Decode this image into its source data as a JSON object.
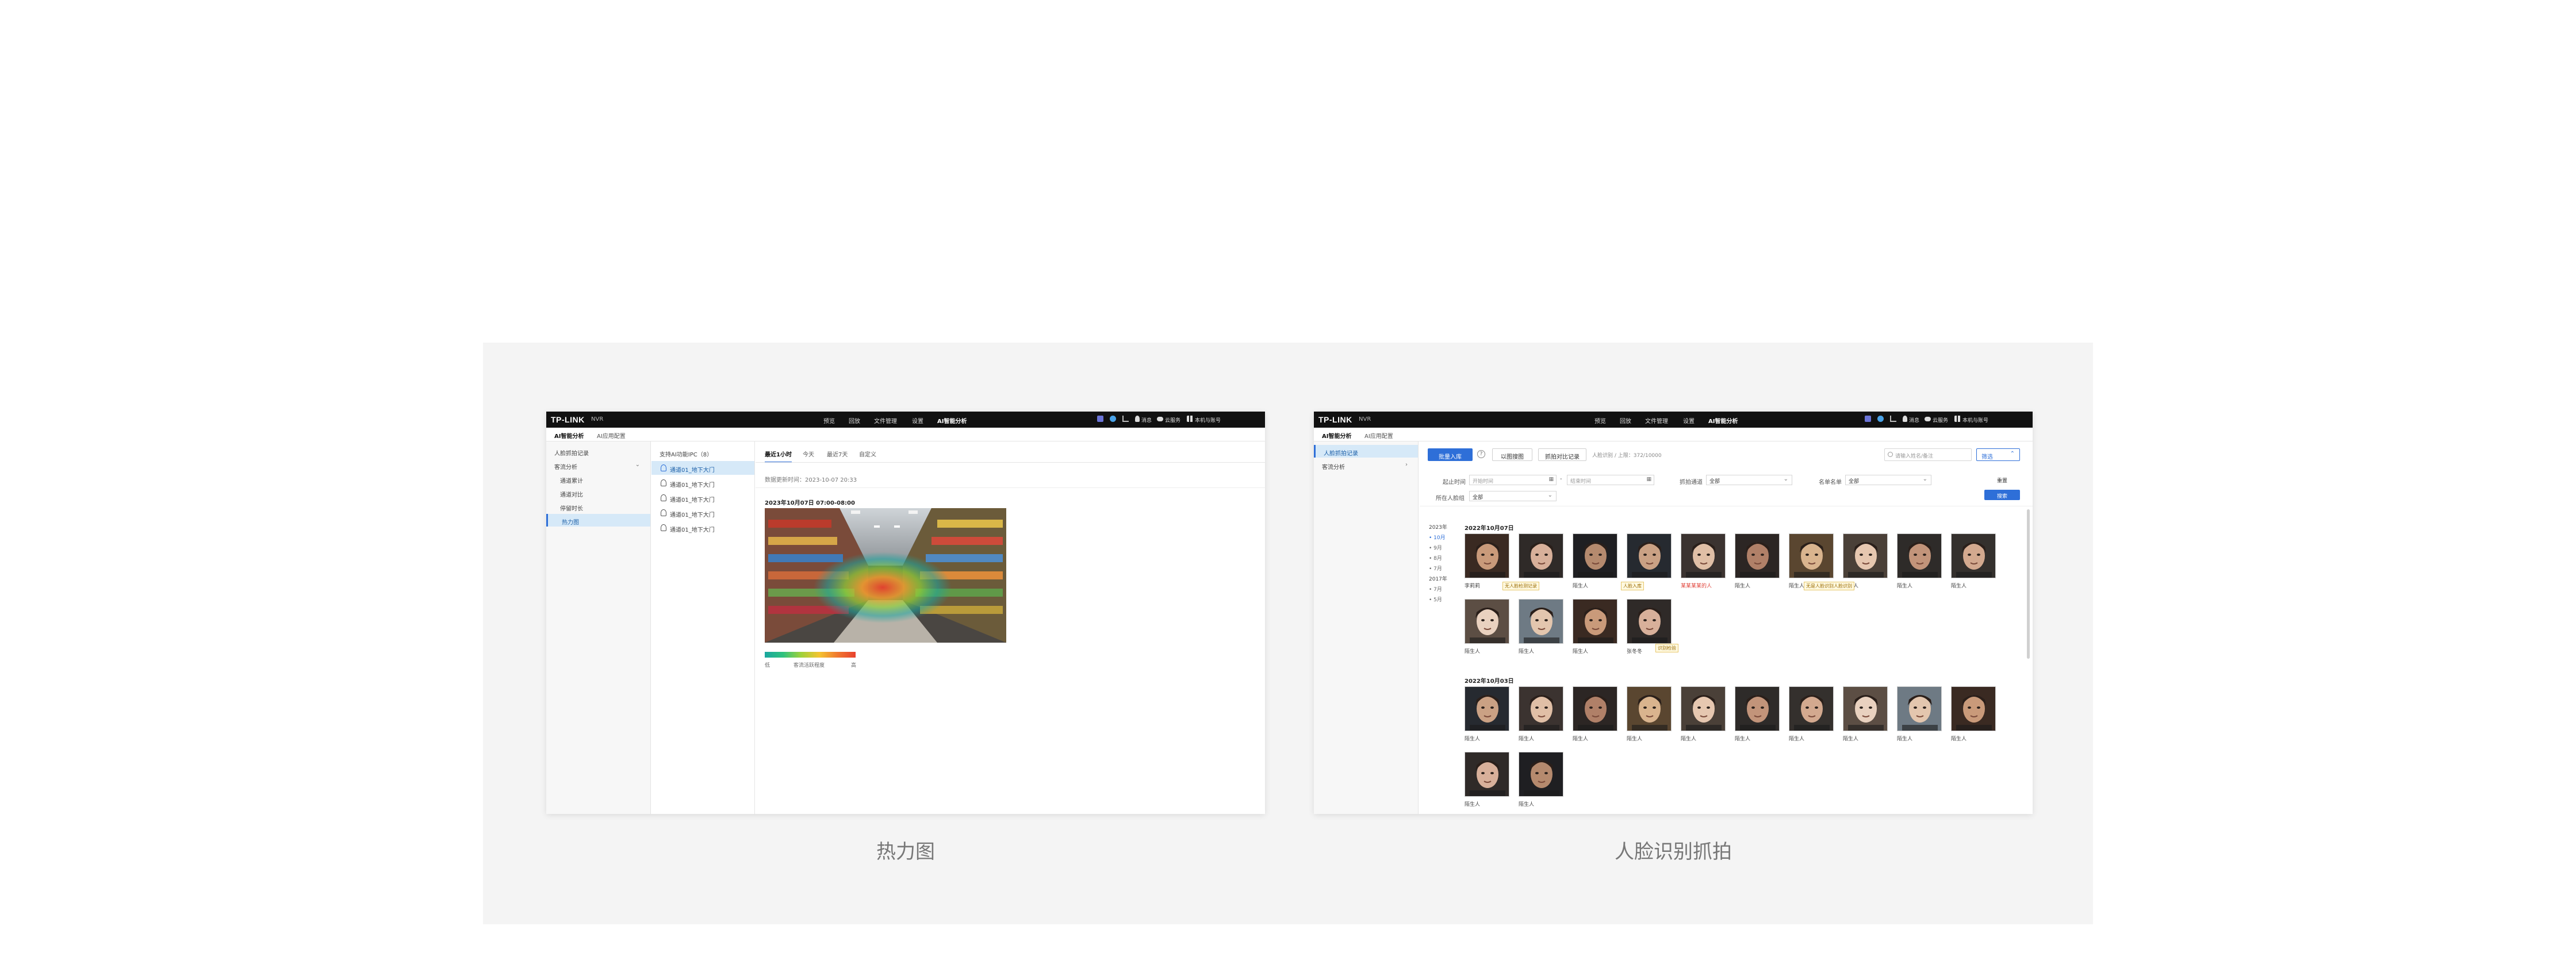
{
  "app": {
    "logo": "TP-LINK",
    "product": "NVR",
    "nav": [
      "预览",
      "回放",
      "文件管理",
      "设置",
      "AI智能分析"
    ],
    "nav_active": 4,
    "right_items": [
      "消息",
      "云服务",
      "本机与账号"
    ]
  },
  "subtabs": [
    "AI智能分析",
    "AI应用配置"
  ],
  "captions": {
    "heatmap": "热力图",
    "face": "人脸识别抓拍"
  },
  "heatmap_screen": {
    "sidebar": [
      "人脸抓拍记录",
      "客流分析",
      "通道累计",
      "通道对比",
      "停留时长",
      "热力图"
    ],
    "ipc_header": "支持AI功能IPC（8）",
    "ipc_items": [
      "通道01_地下大门",
      "通道01_地下大门",
      "通道01_地下大门",
      "通道01_地下大门",
      "通道01_地下大门"
    ],
    "time_tabs": [
      "最近1小时",
      "今天",
      "最近7天",
      "自定义"
    ],
    "update_text": "数据更新时间：2023-10-07 20:33",
    "heat_title": "2023年10月07日 07:00-08:00",
    "legend": {
      "low": "低",
      "mid": "客流活跃程度",
      "high": "高"
    },
    "colors": {
      "accent": "#2e6fd8",
      "selected": "#d6e9f8"
    }
  },
  "face_screen": {
    "sidebar": [
      "人脸抓拍记录",
      "客流分析"
    ],
    "toolbar": {
      "add": "批量入库",
      "compare": "以图搜图",
      "library": "抓拍对比记录",
      "count": "人脸识别 / 上限：372/10000",
      "search_placeholder": "请输入姓名/备注",
      "filter": "筛选"
    },
    "filters": {
      "time_label": "起止时间",
      "start_placeholder": "开始时间",
      "end_placeholder": "结束时间",
      "channel_label": "抓拍通道",
      "channel_value": "全部",
      "list_label": "名单名单",
      "list_value": "全部",
      "group_label": "所在人脸组",
      "group_value": "全部",
      "reset": "重置",
      "search": "搜索"
    },
    "years": [
      {
        "year": "2023年",
        "months": [
          "10月",
          "9月",
          "8月",
          "7月"
        ]
      },
      {
        "year": "2017年",
        "months": [
          "7月",
          "5月"
        ]
      }
    ],
    "groups": [
      {
        "date": "2022年10月07日",
        "faces": [
          {
            "name": "李莉莉"
          },
          {
            "name": "陌生人"
          },
          {
            "name": "陌生人"
          },
          {
            "name": "陌生人"
          },
          {
            "name": "某某某某的人",
            "red": true
          },
          {
            "name": "陌生人"
          },
          {
            "name": "陌生人"
          },
          {
            "name": "陌生人"
          },
          {
            "name": "陌生人"
          },
          {
            "name": "陌生人"
          },
          {
            "name": "陌生人"
          },
          {
            "name": "陌生人"
          },
          {
            "name": "陌生人"
          },
          {
            "name": "张冬冬"
          }
        ]
      },
      {
        "date": "2022年10月03日",
        "faces": [
          {
            "name": "陌生人"
          },
          {
            "name": "陌生人"
          },
          {
            "name": "陌生人"
          },
          {
            "name": "陌生人"
          },
          {
            "name": "陌生人"
          },
          {
            "name": "陌生人"
          },
          {
            "name": "陌生人"
          },
          {
            "name": "陌生人"
          },
          {
            "name": "陌生人"
          },
          {
            "name": "陌生人"
          },
          {
            "name": "陌生人"
          },
          {
            "name": "陌生人"
          }
        ]
      }
    ],
    "tags": [
      "无人脸检测记录",
      "人脸入库",
      "无是人脸识别人脸识别",
      "识别检验"
    ]
  }
}
